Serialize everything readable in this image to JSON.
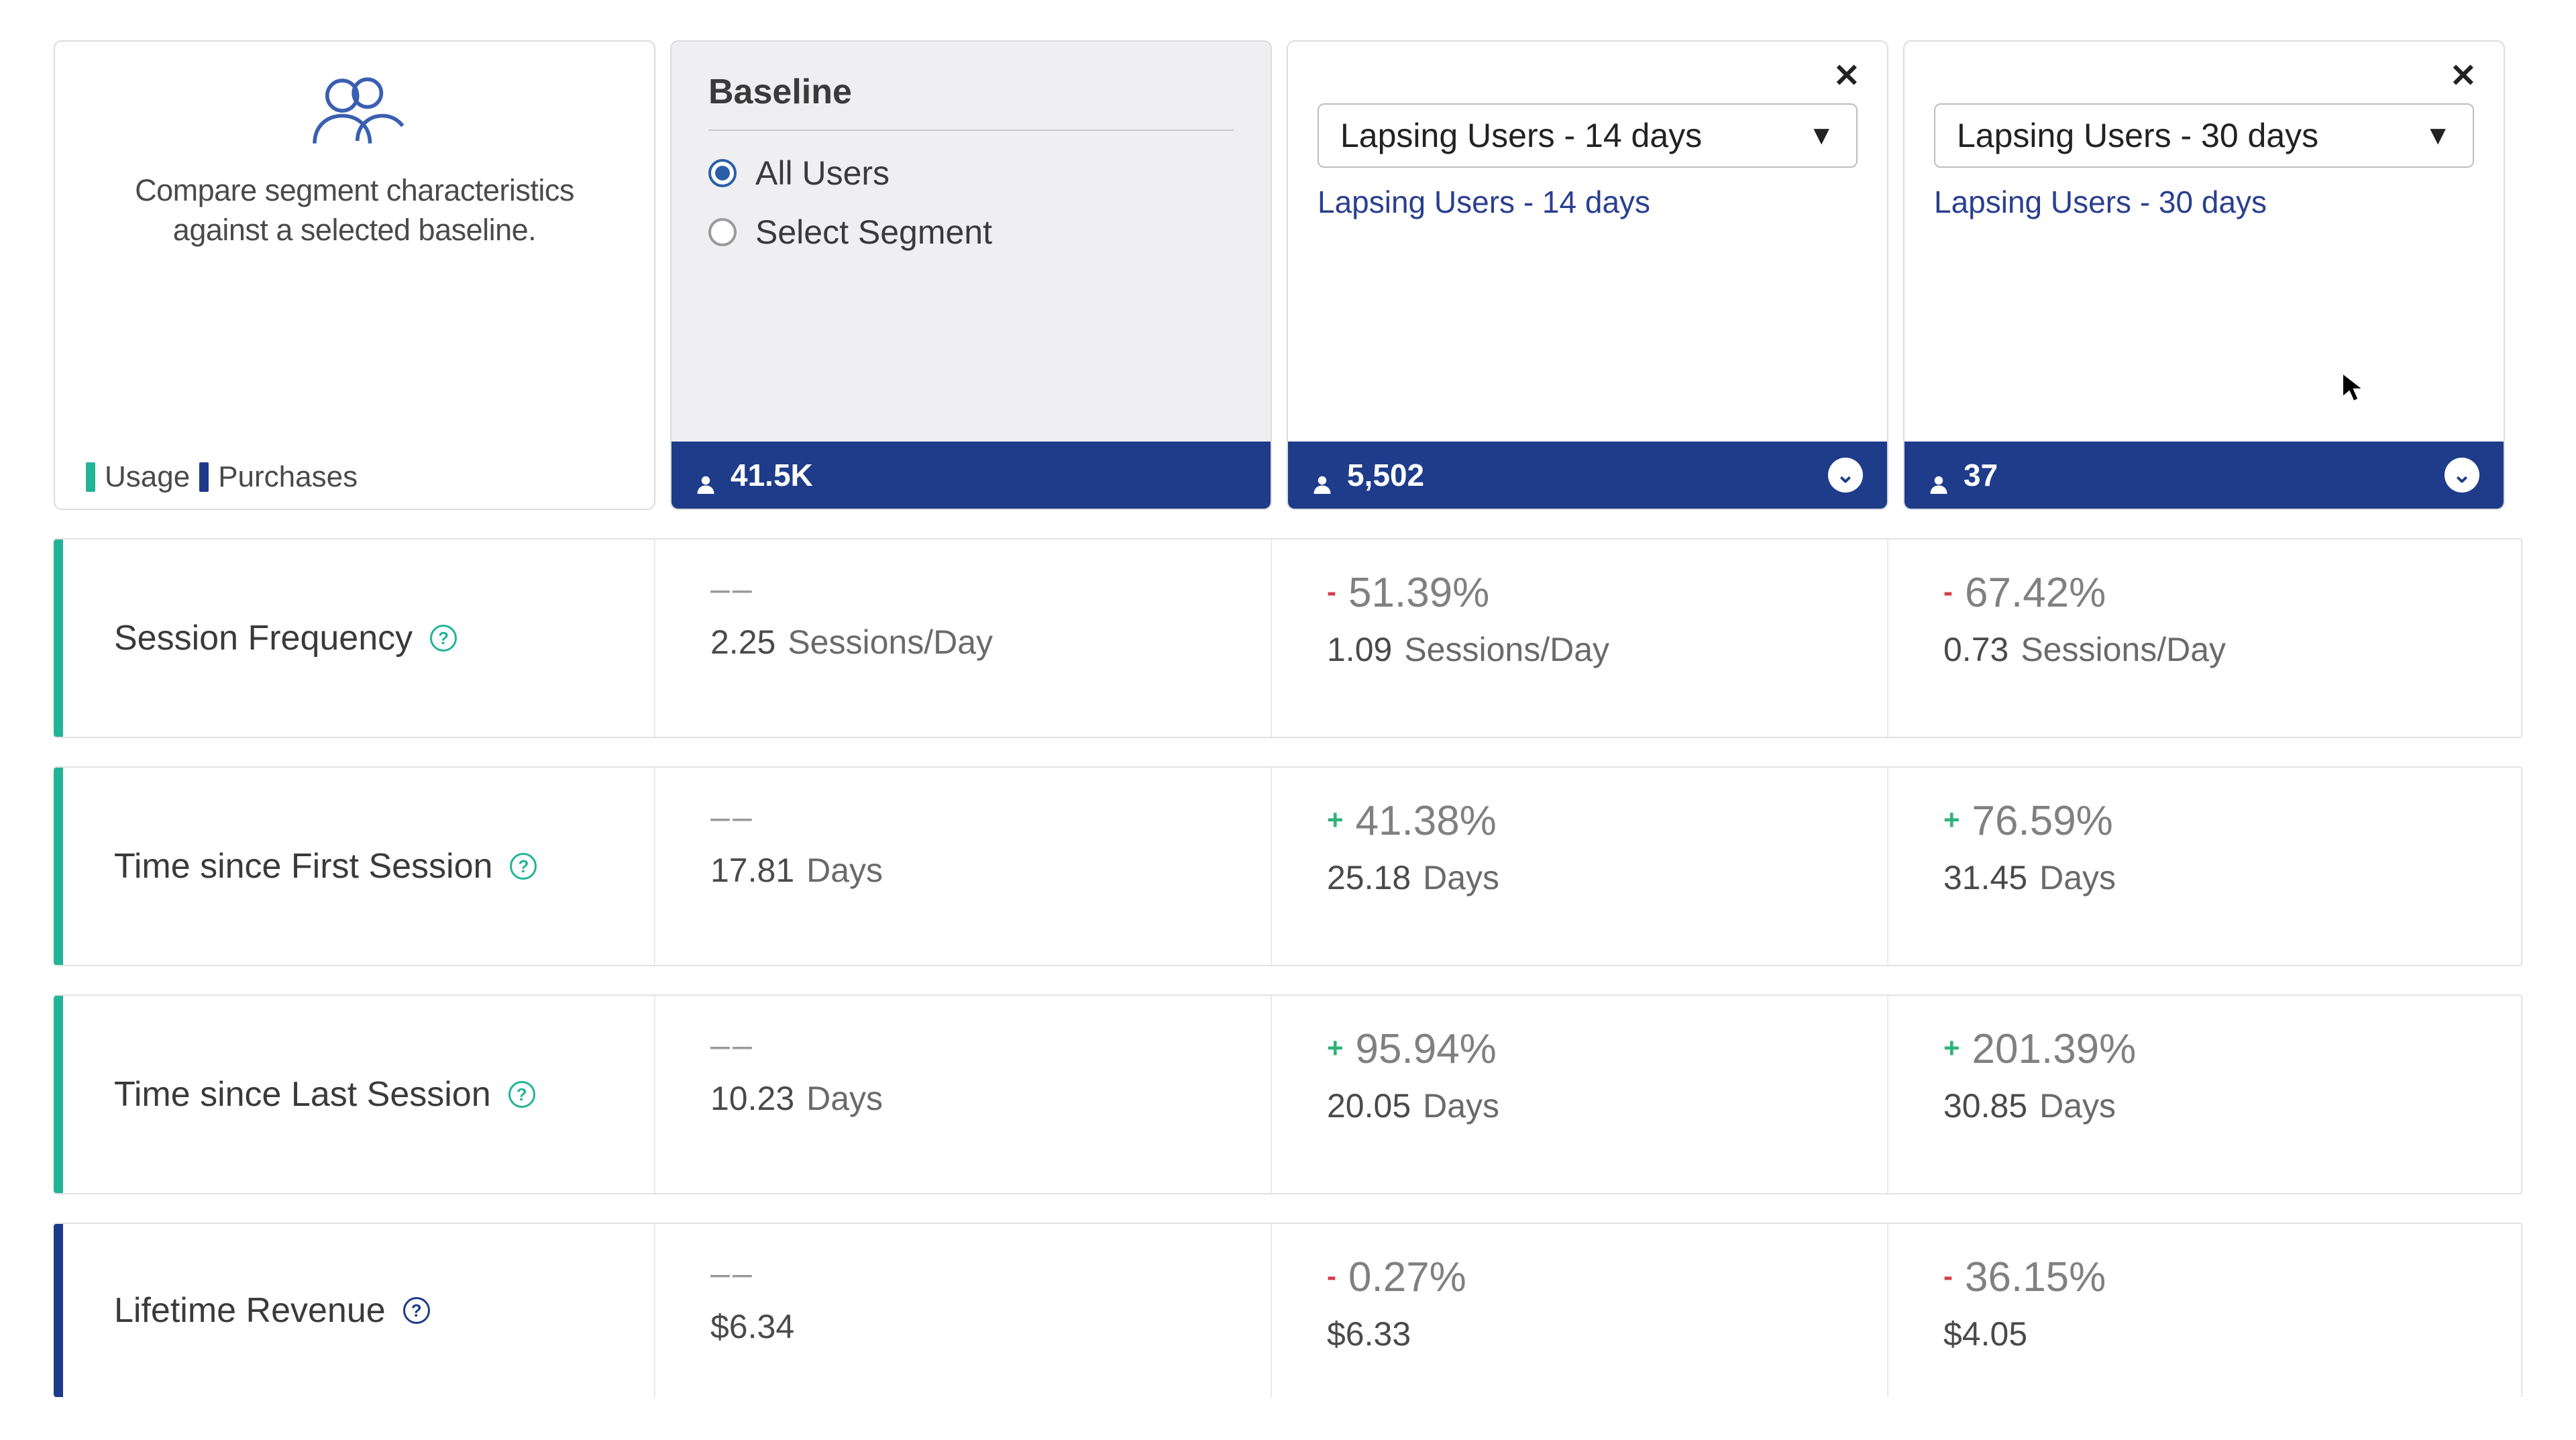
{
  "intro": {
    "text": "Compare segment characteristics against a selected baseline.",
    "legend_usage": "Usage",
    "legend_purchases": "Purchases"
  },
  "baseline": {
    "title": "Baseline",
    "opt_all": "All Users",
    "opt_select": "Select Segment",
    "count": "41.5K"
  },
  "segA": {
    "select_label": "Lapsing Users - 14 days",
    "link": "Lapsing Users - 14 days",
    "count": "5,502"
  },
  "segB": {
    "select_label": "Lapsing Users - 30 days",
    "link": "Lapsing Users - 30 days",
    "count": "37"
  },
  "rows": [
    {
      "label": "Session Frequency",
      "baseline_val": "2.25",
      "baseline_unit": "Sessions/Day",
      "a_sign": "-",
      "a_delta": "51.39%",
      "a_val": "1.09",
      "a_unit": "Sessions/Day",
      "b_sign": "-",
      "b_delta": "67.42%",
      "b_val": "0.73",
      "b_unit": "Sessions/Day"
    },
    {
      "label": "Time since First Session",
      "baseline_val": "17.81",
      "baseline_unit": "Days",
      "a_sign": "+",
      "a_delta": "41.38%",
      "a_val": "25.18",
      "a_unit": "Days",
      "b_sign": "+",
      "b_delta": "76.59%",
      "b_val": "31.45",
      "b_unit": "Days"
    },
    {
      "label": "Time since Last Session",
      "baseline_val": "10.23",
      "baseline_unit": "Days",
      "a_sign": "+",
      "a_delta": "95.94%",
      "a_val": "20.05",
      "a_unit": "Days",
      "b_sign": "+",
      "b_delta": "201.39%",
      "b_val": "30.85",
      "b_unit": "Days"
    },
    {
      "label": "Lifetime Revenue",
      "baseline_val": "$6.34",
      "baseline_unit": "",
      "a_sign": "-",
      "a_delta": "0.27%",
      "a_val": "$6.33",
      "a_unit": "",
      "b_sign": "-",
      "b_delta": "36.15%",
      "b_val": "$4.05",
      "b_unit": ""
    }
  ],
  "colors": {
    "accent_green": "#24b398",
    "accent_blue": "#1e3a8a",
    "bar": "#1e3c8a",
    "neg": "#d63c4a",
    "pos": "#2fb37a"
  }
}
